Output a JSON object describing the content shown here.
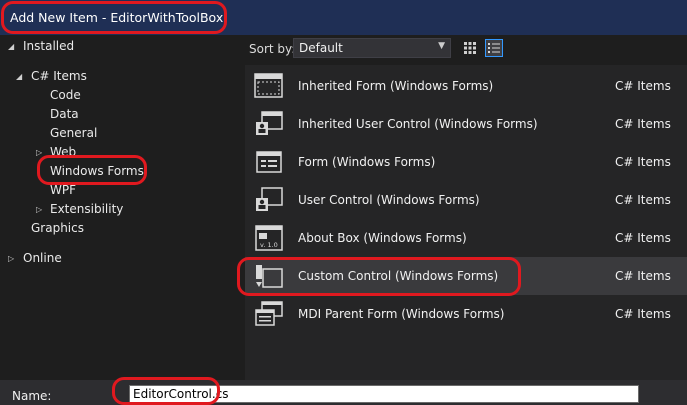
{
  "window": {
    "title": "Add New Item - EditorWithToolBox"
  },
  "tree": {
    "installed": "Installed",
    "csharp_items": "C# Items",
    "code": "Code",
    "data": "Data",
    "general": "General",
    "web": "Web",
    "windows_forms": "Windows Forms",
    "wpf": "WPF",
    "extensibility": "Extensibility",
    "graphics": "Graphics",
    "online": "Online"
  },
  "toolbar": {
    "sort_label": "Sort by:",
    "sort_value": "Default"
  },
  "templates": [
    {
      "name": "Inherited Form (Windows Forms)",
      "category": "C# Items"
    },
    {
      "name": "Inherited User Control (Windows Forms)",
      "category": "C# Items"
    },
    {
      "name": "Form (Windows Forms)",
      "category": "C# Items"
    },
    {
      "name": "User Control (Windows Forms)",
      "category": "C# Items"
    },
    {
      "name": "About Box (Windows Forms)",
      "category": "C# Items"
    },
    {
      "name": "Custom Control (Windows Forms)",
      "category": "C# Items"
    },
    {
      "name": "MDI Parent Form (Windows Forms)",
      "category": "C# Items"
    }
  ],
  "about_icon_version": "v. 1.0",
  "bottom": {
    "name_label": "Name:",
    "name_value": "EditorControl.cs"
  },
  "colors": {
    "highlight": "#e0191f",
    "title_bar": "#1f2f55",
    "selected_row": "#3a3a3d"
  }
}
